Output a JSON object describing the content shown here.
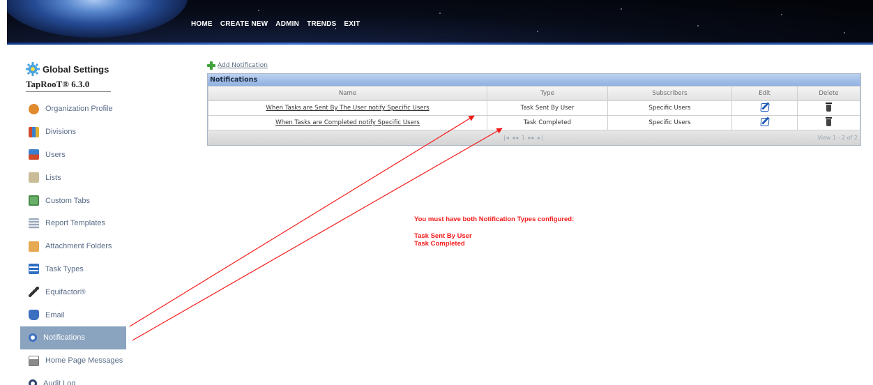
{
  "nav": [
    "HOME",
    "CREATE NEW",
    "ADMIN",
    "TRENDS",
    "EXIT"
  ],
  "sidebar": {
    "title": "Global Settings",
    "subtitle": "TapRooT® 6.3.0",
    "items": [
      {
        "label": "Organization Profile",
        "icon": "organization-icon",
        "color": "#e08a2e"
      },
      {
        "label": "Divisions",
        "icon": "divisions-icon",
        "color": "#d04a2c"
      },
      {
        "label": "Users",
        "icon": "users-icon",
        "color": "#3c7fcf"
      },
      {
        "label": "Lists",
        "icon": "lists-icon",
        "color": "#b8a67a"
      },
      {
        "label": "Custom Tabs",
        "icon": "custom-tabs-icon",
        "color": "#5aa05a"
      },
      {
        "label": "Report Templates",
        "icon": "report-templates-icon",
        "color": "#8a9ab0"
      },
      {
        "label": "Attachment Folders",
        "icon": "folder-icon",
        "color": "#e0a54a"
      },
      {
        "label": "Task Types",
        "icon": "task-types-icon",
        "color": "#2f6fc4"
      },
      {
        "label": "Equifactor®",
        "icon": "wrench-icon",
        "color": "#444444"
      },
      {
        "label": "Email",
        "icon": "email-icon",
        "color": "#3c6fc0"
      },
      {
        "label": "Notifications",
        "icon": "notifications-icon",
        "color": "#d8e6f5",
        "active": true
      },
      {
        "label": "Home Page Messages",
        "icon": "messages-icon",
        "color": "#777777"
      },
      {
        "label": "Audit Log",
        "icon": "search-icon",
        "color": "#2a3f6a"
      }
    ]
  },
  "main": {
    "add_label": "Add Notification",
    "grid_title": "Notifications",
    "columns": [
      "Name",
      "Type",
      "Subscribers",
      "Edit",
      "Delete"
    ],
    "rows": [
      {
        "name": "When Tasks are Sent By The User notify Specific Users",
        "type": "Task Sent By User",
        "subscribers": "Specific Users"
      },
      {
        "name": "When Tasks are Completed notify Specific Users",
        "type": "Task Completed",
        "subscribers": "Specific Users"
      }
    ],
    "pager": "1",
    "view_text": "View 1 - 2 of 2"
  },
  "annotation": {
    "line1": "You must have both Notification Types configured:",
    "line2": "Task Sent By User",
    "line3": "Task Completed",
    "color": "#f41a1a"
  }
}
